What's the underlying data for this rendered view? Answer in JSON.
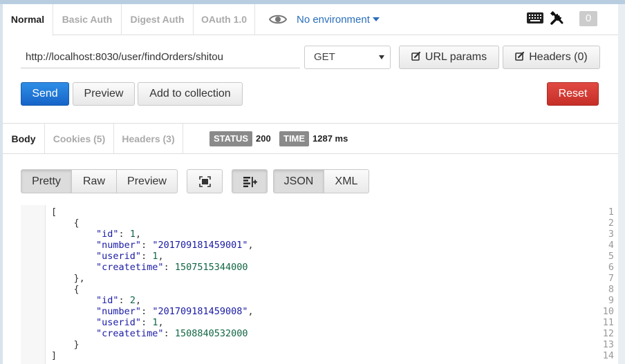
{
  "request_tabs": [
    {
      "label": "Normal",
      "active": true
    },
    {
      "label": "Basic Auth",
      "active": false
    },
    {
      "label": "Digest Auth",
      "active": false
    },
    {
      "label": "OAuth 1.0",
      "active": false
    }
  ],
  "environment": {
    "label": "No environment"
  },
  "notifications": {
    "count": "0"
  },
  "request": {
    "url": "http://localhost:8030/user/findOrders/shitou",
    "method": "GET",
    "url_params_label": "URL params",
    "headers_label": "Headers (0)"
  },
  "actions": {
    "send": "Send",
    "preview": "Preview",
    "add_to_collection": "Add to collection",
    "reset": "Reset"
  },
  "response_tabs": [
    {
      "label": "Body",
      "active": true
    },
    {
      "label": "Cookies (5)",
      "active": false
    },
    {
      "label": "Headers (3)",
      "active": false
    }
  ],
  "status": {
    "label": "STATUS",
    "value": "200"
  },
  "time": {
    "label": "TIME",
    "value": "1287 ms"
  },
  "view_modes": [
    {
      "label": "Pretty",
      "active": true
    },
    {
      "label": "Raw",
      "active": false
    },
    {
      "label": "Preview",
      "active": false
    }
  ],
  "formats": [
    {
      "label": "JSON",
      "active": true
    },
    {
      "label": "XML",
      "active": false
    }
  ],
  "response_body": {
    "line_numbers": [
      "1",
      "2",
      "3",
      "4",
      "5",
      "6",
      "7",
      "8",
      "9",
      "10",
      "11",
      "12",
      "13",
      "14"
    ],
    "lines": [
      "[",
      "    {",
      "        \"id\": 1,",
      "        \"number\": \"201709181459001\",",
      "        \"userid\": 1,",
      "        \"createtime\": 1507515344000",
      "    },",
      "    {",
      "        \"id\": 2,",
      "        \"number\": \"201709181459008\",",
      "        \"userid\": 1,",
      "        \"createtime\": 1508840532000",
      "    }",
      "]"
    ]
  },
  "colors": {
    "send": "#1a73d2",
    "reset": "#d13a33",
    "env_link": "#2a6ebb",
    "pill": "#8a8a8a",
    "json_key": "#1a1aa6",
    "json_number": "#116644"
  }
}
